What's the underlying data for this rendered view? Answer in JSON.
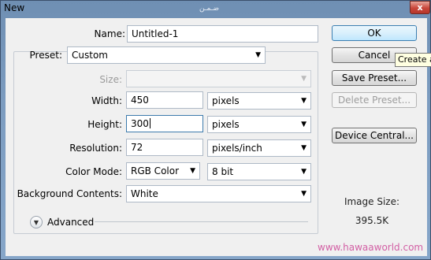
{
  "window": {
    "title": "New",
    "title_decoration": "ضـمـن",
    "close_glyph": "x"
  },
  "form": {
    "name_label": "Name:",
    "name_value": "Untitled-1",
    "preset_label": "Preset:",
    "preset_value": "Custom",
    "size_label": "Size:",
    "size_value": "",
    "width_label": "Width:",
    "width_value": "450",
    "width_unit": "pixels",
    "height_label": "Height:",
    "height_value": "300",
    "height_unit": "pixels",
    "resolution_label": "Resolution:",
    "resolution_value": "72",
    "resolution_unit": "pixels/inch",
    "color_mode_label": "Color Mode:",
    "color_mode_value": "RGB Color",
    "bit_depth_value": "8 bit",
    "background_label": "Background Contents:",
    "background_value": "White",
    "advanced_label": "Advanced"
  },
  "buttons": {
    "ok": "OK",
    "cancel": "Cancel",
    "save_preset": "Save Preset...",
    "delete_preset": "Delete Preset...",
    "device_central": "Device Central..."
  },
  "tooltip": "Create a",
  "image_size": {
    "label": "Image Size:",
    "value": "395.5K"
  },
  "watermark": "www.hawaaworld.com",
  "colors": {
    "title_bar": "#7c9cc0",
    "close_button": "#c9463a",
    "default_button": "#bee6fd",
    "watermark": "#d25fa4"
  }
}
